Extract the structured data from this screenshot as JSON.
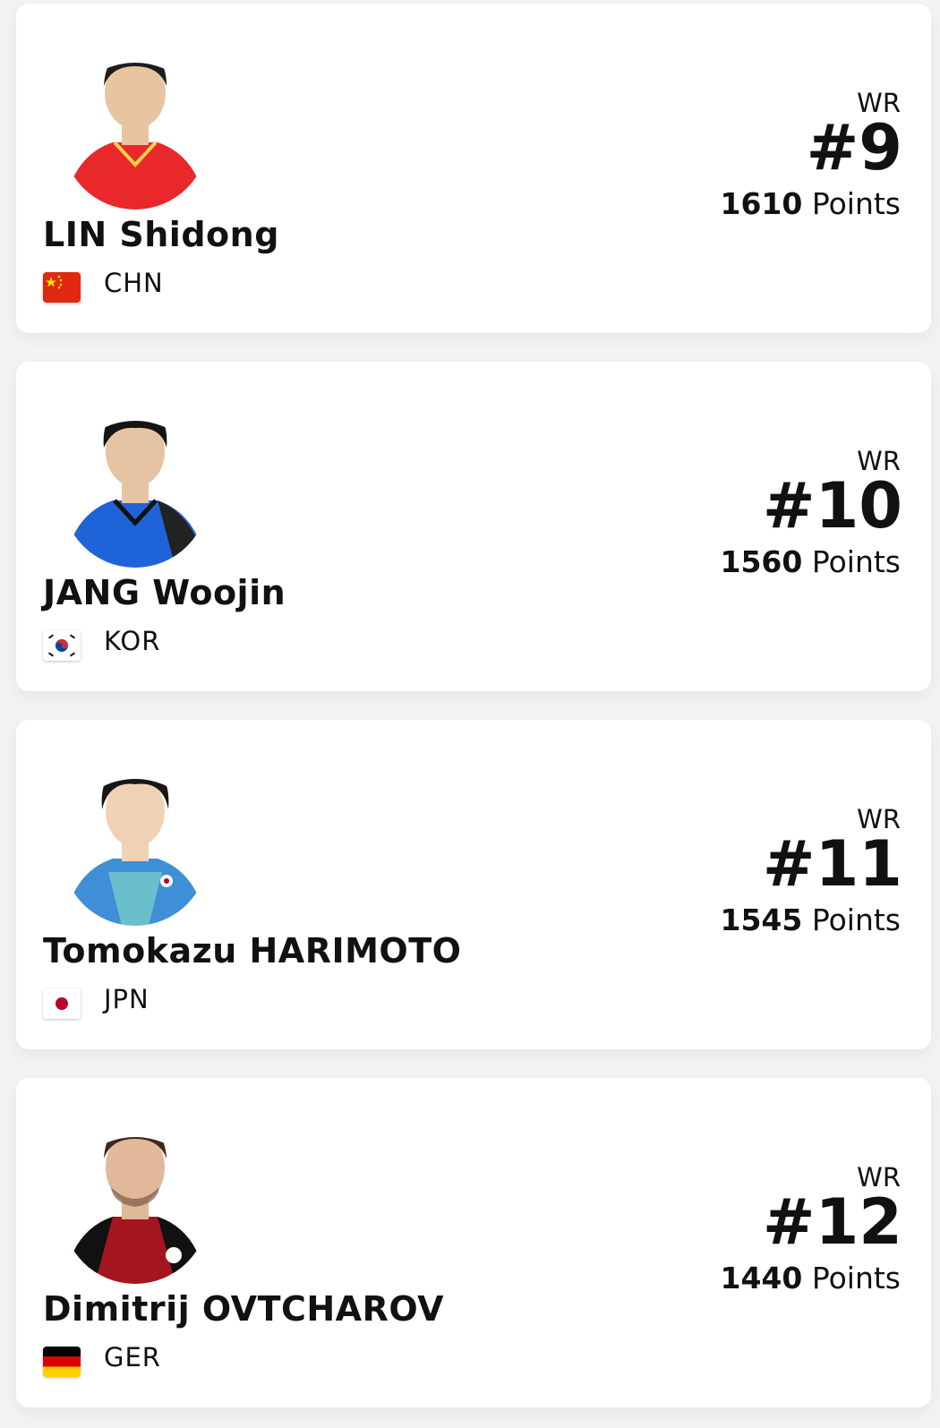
{
  "players": [
    {
      "name": "LIN Shidong",
      "country": "CHN",
      "wr_label": "WR",
      "rank": "#9",
      "points": "1610",
      "points_label": "Points",
      "shirt_color": "#e8282a",
      "hair_color": "#1c1c1c",
      "skin_color": "#e8c4a0"
    },
    {
      "name": "JANG Woojin",
      "country": "KOR",
      "wr_label": "WR",
      "rank": "#10",
      "points": "1560",
      "points_label": "Points",
      "shirt_color": "#1f63d8",
      "hair_color": "#141414",
      "skin_color": "#e6c3a2"
    },
    {
      "name": "Tomokazu HARIMOTO",
      "country": "JPN",
      "wr_label": "WR",
      "rank": "#11",
      "points": "1545",
      "points_label": "Points",
      "shirt_color": "#3f8fd6",
      "hair_color": "#161616",
      "skin_color": "#efd2b6"
    },
    {
      "name": "Dimitrij OVTCHAROV",
      "country": "GER",
      "wr_label": "WR",
      "rank": "#12",
      "points": "1440",
      "points_label": "Points",
      "shirt_color": "#a4161f",
      "hair_color": "#3a2a22",
      "skin_color": "#e2b89a"
    }
  ]
}
